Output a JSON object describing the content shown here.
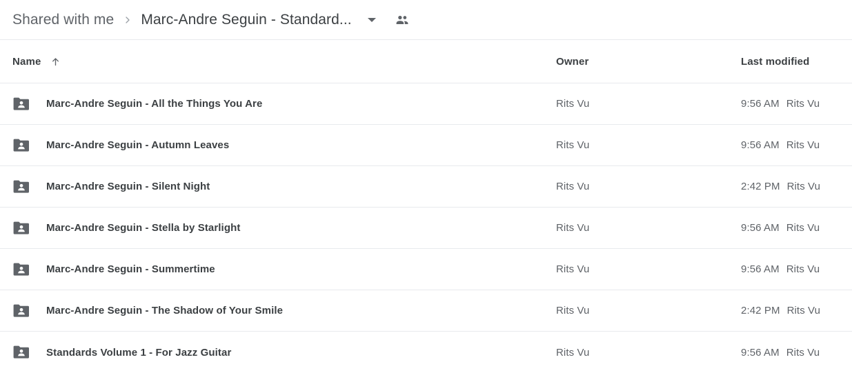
{
  "breadcrumb": {
    "parent": "Shared with me",
    "separator_icon": "chevron-right-icon",
    "current": "Marc-Andre Seguin - Standard...",
    "caret_icon": "chevron-down-icon",
    "people_icon": "people-icon"
  },
  "columns": {
    "name": "Name",
    "owner": "Owner",
    "last_modified": "Last modified",
    "sort_icon": "arrow-up-icon",
    "sort_direction": "ascending"
  },
  "colors": {
    "text_primary": "#3c4043",
    "text_secondary": "#5f6368",
    "divider": "#e8eaed",
    "folder_icon": "#5f6368",
    "background": "#ffffff"
  },
  "rows": [
    {
      "icon": "shared-folder-icon",
      "name": "Marc-Andre Seguin - All the Things You Are",
      "owner": "Rits Vu",
      "modified_time": "9:56 AM",
      "modified_by": "Rits Vu"
    },
    {
      "icon": "shared-folder-icon",
      "name": "Marc-Andre Seguin - Autumn Leaves",
      "owner": "Rits Vu",
      "modified_time": "9:56 AM",
      "modified_by": "Rits Vu"
    },
    {
      "icon": "shared-folder-icon",
      "name": "Marc-Andre Seguin - Silent Night",
      "owner": "Rits Vu",
      "modified_time": "2:42 PM",
      "modified_by": "Rits Vu"
    },
    {
      "icon": "shared-folder-icon",
      "name": "Marc-Andre Seguin - Stella by Starlight",
      "owner": "Rits Vu",
      "modified_time": "9:56 AM",
      "modified_by": "Rits Vu"
    },
    {
      "icon": "shared-folder-icon",
      "name": "Marc-Andre Seguin - Summertime",
      "owner": "Rits Vu",
      "modified_time": "9:56 AM",
      "modified_by": "Rits Vu"
    },
    {
      "icon": "shared-folder-icon",
      "name": "Marc-Andre Seguin - The Shadow of Your Smile",
      "owner": "Rits Vu",
      "modified_time": "2:42 PM",
      "modified_by": "Rits Vu"
    },
    {
      "icon": "shared-folder-icon",
      "name": "Standards Volume 1 - For Jazz Guitar",
      "owner": "Rits Vu",
      "modified_time": "9:56 AM",
      "modified_by": "Rits Vu"
    }
  ]
}
